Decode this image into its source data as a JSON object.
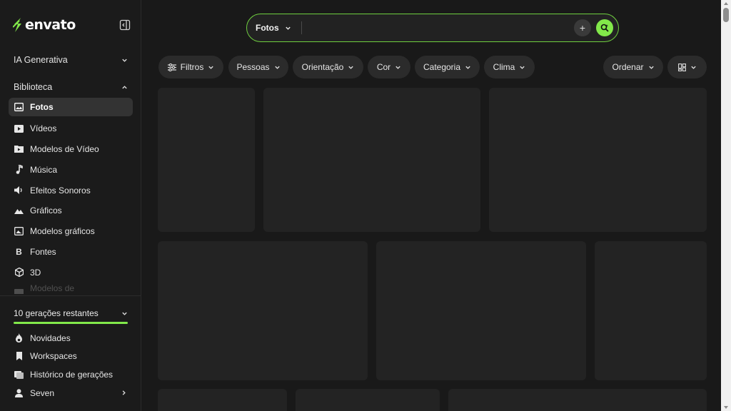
{
  "brand": {
    "name": "envato",
    "accent": "#82e84a"
  },
  "sidebar": {
    "sections": {
      "ai": {
        "label": "IA Generativa"
      },
      "library": {
        "label": "Biblioteca"
      }
    },
    "items": [
      {
        "label": "Fotos",
        "icon": "image-icon",
        "active": true
      },
      {
        "label": "Vídeos",
        "icon": "video-icon"
      },
      {
        "label": "Modelos de Vídeo",
        "icon": "video-template-icon"
      },
      {
        "label": "Música",
        "icon": "music-note-icon"
      },
      {
        "label": "Efeitos Sonoros",
        "icon": "speaker-icon"
      },
      {
        "label": "Gráficos",
        "icon": "mountain-icon"
      },
      {
        "label": "Modelos gráficos",
        "icon": "graphic-template-icon"
      },
      {
        "label": "Fontes",
        "icon": "font-b-icon"
      },
      {
        "label": "3D",
        "icon": "cube-icon"
      },
      {
        "label": "Modelos de Apresentação",
        "icon": "presentation-icon"
      }
    ],
    "generations": {
      "label": "10 gerações restantes",
      "progress": 1.0
    },
    "bottom": [
      {
        "label": "Novidades",
        "icon": "flame-icon"
      },
      {
        "label": "Workspaces",
        "icon": "bookmark-icon"
      },
      {
        "label": "Histórico de gerações",
        "icon": "history-icon"
      },
      {
        "label": "Seven",
        "icon": "user-icon"
      }
    ]
  },
  "search": {
    "type_label": "Fotos",
    "value": "",
    "plus_label": "+"
  },
  "filters": [
    "Filtros",
    "Pessoas",
    "Orientação",
    "Cor",
    "Categoria",
    "Clima"
  ],
  "sort_label": "Ordenar",
  "layout_toggle": {
    "icon": "grid-layout-icon"
  }
}
